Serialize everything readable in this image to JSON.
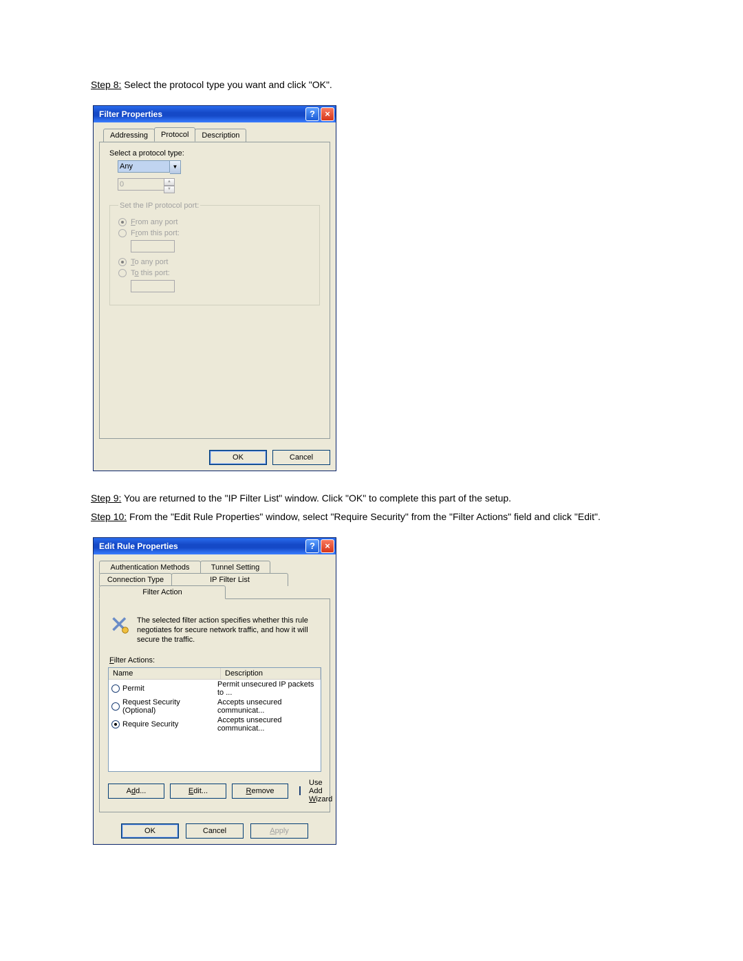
{
  "steps": {
    "s8": {
      "label": "Step 8:",
      "text": " Select the protocol type you want and click \"OK\"."
    },
    "s9": {
      "label": "Step 9:",
      "text": " You are returned to the \"IP Filter List\" window. Click \"OK\" to complete this part of the setup."
    },
    "s10": {
      "label": "Step 10:",
      "text": " From the \"Edit Rule Properties\" window, select \"Require Security\" from the \"Filter Actions\" field and click \"Edit\"."
    }
  },
  "win1": {
    "title": "Filter Properties",
    "help": "?",
    "close": "×",
    "tabs": {
      "addressing": "Addressing",
      "protocol": "Protocol",
      "description": "Description"
    },
    "selectLabel": "Select a protocol type:",
    "comboValue": "Any",
    "spinValue": "0",
    "fieldset": {
      "legend": "Set the IP protocol port:",
      "fromAny": "From any port",
      "fromThis": "From this port:",
      "toAny": "To any port",
      "toThis": "To this port:"
    },
    "ok": "OK",
    "cancel": "Cancel"
  },
  "win2": {
    "title": "Edit Rule Properties",
    "help": "?",
    "close": "×",
    "tabs": {
      "auth": "Authentication Methods",
      "tunnel": "Tunnel Setting",
      "conn": "Connection Type",
      "iplist": "IP Filter List",
      "action": "Filter Action"
    },
    "info": "The selected filter action specifies whether this rule negotiates for secure network traffic, and how it will secure the traffic.",
    "listLabel": "Filter Actions:",
    "cols": {
      "name": "Name",
      "desc": "Description"
    },
    "rows": [
      {
        "name": "Permit",
        "desc": "Permit unsecured IP packets to ...",
        "sel": false
      },
      {
        "name": "Request Security (Optional)",
        "desc": "Accepts unsecured communicat...",
        "sel": false
      },
      {
        "name": "Require Security",
        "desc": "Accepts unsecured communicat...",
        "sel": true
      }
    ],
    "add": "Add...",
    "edit": "Edit...",
    "remove": "Remove",
    "wizard": "Use Add Wizard",
    "ok": "OK",
    "cancel": "Cancel",
    "apply": "Apply"
  }
}
